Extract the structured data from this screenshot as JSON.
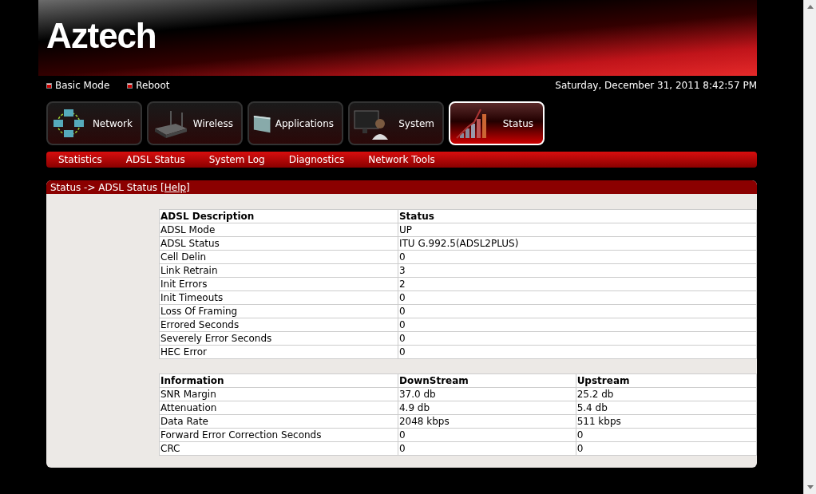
{
  "brand": "Aztech",
  "top_links": [
    "Basic Mode",
    "Reboot"
  ],
  "datetime": "Saturday, December 31, 2011 8:42:57 PM",
  "tabs": [
    {
      "label": "Network",
      "kind": "network",
      "selected": false
    },
    {
      "label": "Wireless",
      "kind": "router",
      "selected": false
    },
    {
      "label": "Applications",
      "kind": "panel",
      "selected": false
    },
    {
      "label": "System",
      "kind": "user",
      "selected": false
    },
    {
      "label": "Status",
      "kind": "chart",
      "selected": true
    }
  ],
  "submenu": [
    "Statistics",
    "ADSL Status",
    "System Log",
    "Diagnostics",
    "Network Tools"
  ],
  "breadcrumb": {
    "path": "Status -> ADSL Status",
    "help": "[Help]"
  },
  "tables": [
    {
      "columns": [
        "ADSL Description",
        "Status"
      ],
      "rows": [
        [
          "ADSL Mode",
          "UP"
        ],
        [
          "ADSL Status",
          "ITU G.992.5(ADSL2PLUS)"
        ],
        [
          "Cell Delin",
          "0"
        ],
        [
          "Link Retrain",
          "3"
        ],
        [
          "Init Errors",
          "2"
        ],
        [
          "Init Timeouts",
          "0"
        ],
        [
          "Loss Of Framing",
          "0"
        ],
        [
          "Errored Seconds",
          "0"
        ],
        [
          "Severely Error Seconds",
          "0"
        ],
        [
          "HEC Error",
          "0"
        ]
      ]
    },
    {
      "columns": [
        "Information",
        "DownStream",
        "Upstream"
      ],
      "rows": [
        [
          "SNR Margin",
          "37.0 db",
          "25.2 db"
        ],
        [
          "Attenuation",
          "4.9 db",
          "5.4 db"
        ],
        [
          "Data Rate",
          "2048 kbps",
          "511 kbps"
        ],
        [
          "Forward Error Correction Seconds",
          "0",
          "0"
        ],
        [
          "CRC",
          "0",
          "0"
        ]
      ]
    }
  ]
}
